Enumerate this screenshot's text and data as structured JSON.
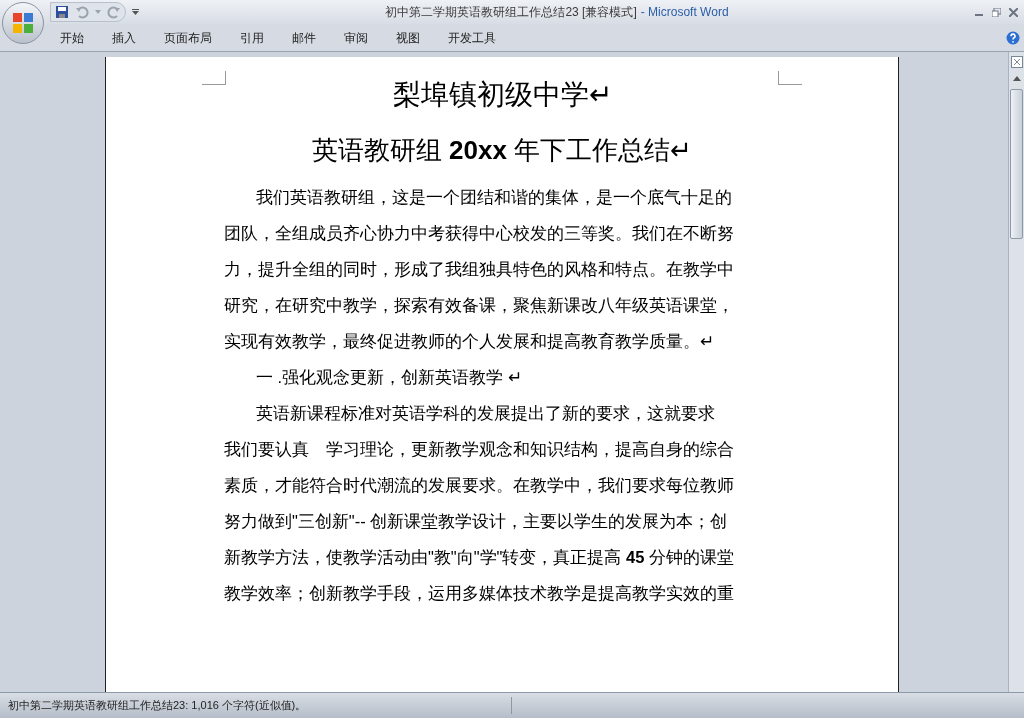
{
  "window": {
    "title": "初中第二学期英语教研组工作总结23 [兼容模式]",
    "app_name": "- Microsoft Word"
  },
  "ribbon_tabs": [
    "开始",
    "插入",
    "页面布局",
    "引用",
    "邮件",
    "审阅",
    "视图",
    "开发工具"
  ],
  "document": {
    "heading": "梨埠镇初级中学↵",
    "subheading": "英语教研组 **20xx** 年下工作总结↵",
    "paragraphs": [
      {
        "kind": "body",
        "lines": [
          "我们英语教研组，这是一个团结和谐的集体，是一个底气十足的",
          "团队，全组成员齐心协力中考获得中心校发的三等奖。我们在不断努",
          "力，提升全组的同时，形成了我组独具特色的风格和特点。在教学中",
          "研究，在研究中教学，探索有效备课，聚焦新课改八年级英语课堂，",
          "实现有效教学，最终促进教师的个人发展和提高教育教学质量。↵"
        ]
      },
      {
        "kind": "section",
        "lines": [
          "一 .强化观念更新，创新英语教学 ↵"
        ]
      },
      {
        "kind": "body",
        "lines": [
          "英语新课程标准对英语学科的发展提出了新的要求，这就要求",
          "我们要认真　学习理论，更新教学观念和知识结构，提高自身的综合",
          "素质，才能符合时代潮流的发展要求。在教学中，我们要求每位教师",
          "努力做到\"三创新\"-- 创新课堂教学设计，主要以学生的发展为本；创",
          "新教学方法，使教学活动由\"教\"向\"学\"转变，真正提高 **45** 分钟的课堂",
          "教学效率；创新教学手段，运用多媒体技术教学是提高教学实效的重"
        ]
      }
    ]
  },
  "status_bar": {
    "text": "初中第二学期英语教研组工作总结23: 1,016 个字符(近似值)。"
  }
}
